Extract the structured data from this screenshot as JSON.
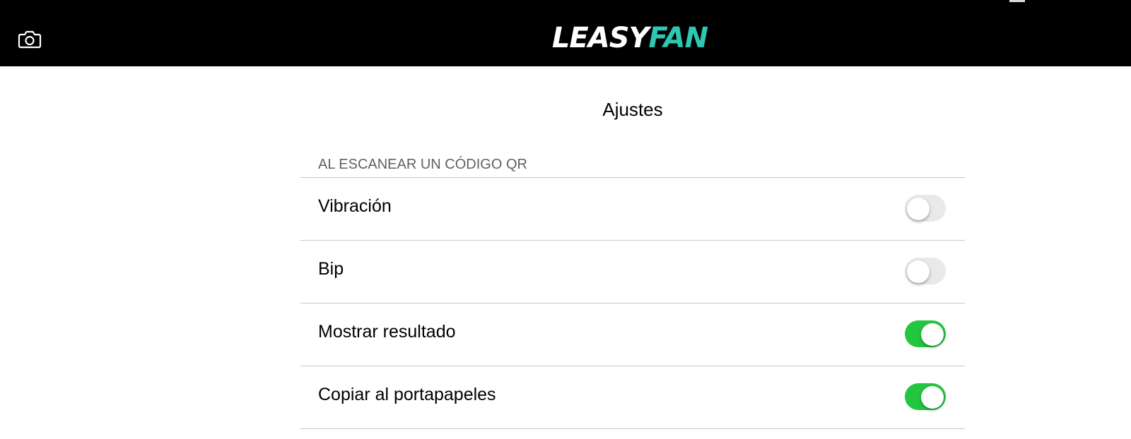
{
  "header": {
    "logo_part1": "LEASY",
    "logo_part2": "FAN",
    "camera_icon": "camera-icon",
    "brand_color": "#2fc7b2"
  },
  "page": {
    "title": "Ajustes"
  },
  "section": {
    "header": "AL ESCANEAR UN CÓDIGO QR",
    "rows": [
      {
        "label": "Vibración",
        "enabled": false
      },
      {
        "label": "Bip",
        "enabled": false
      },
      {
        "label": "Mostrar resultado",
        "enabled": true
      },
      {
        "label": "Copiar al portapapeles",
        "enabled": true
      }
    ]
  },
  "colors": {
    "toggle_on": "#22c63f",
    "toggle_off": "#e9e9ea"
  }
}
